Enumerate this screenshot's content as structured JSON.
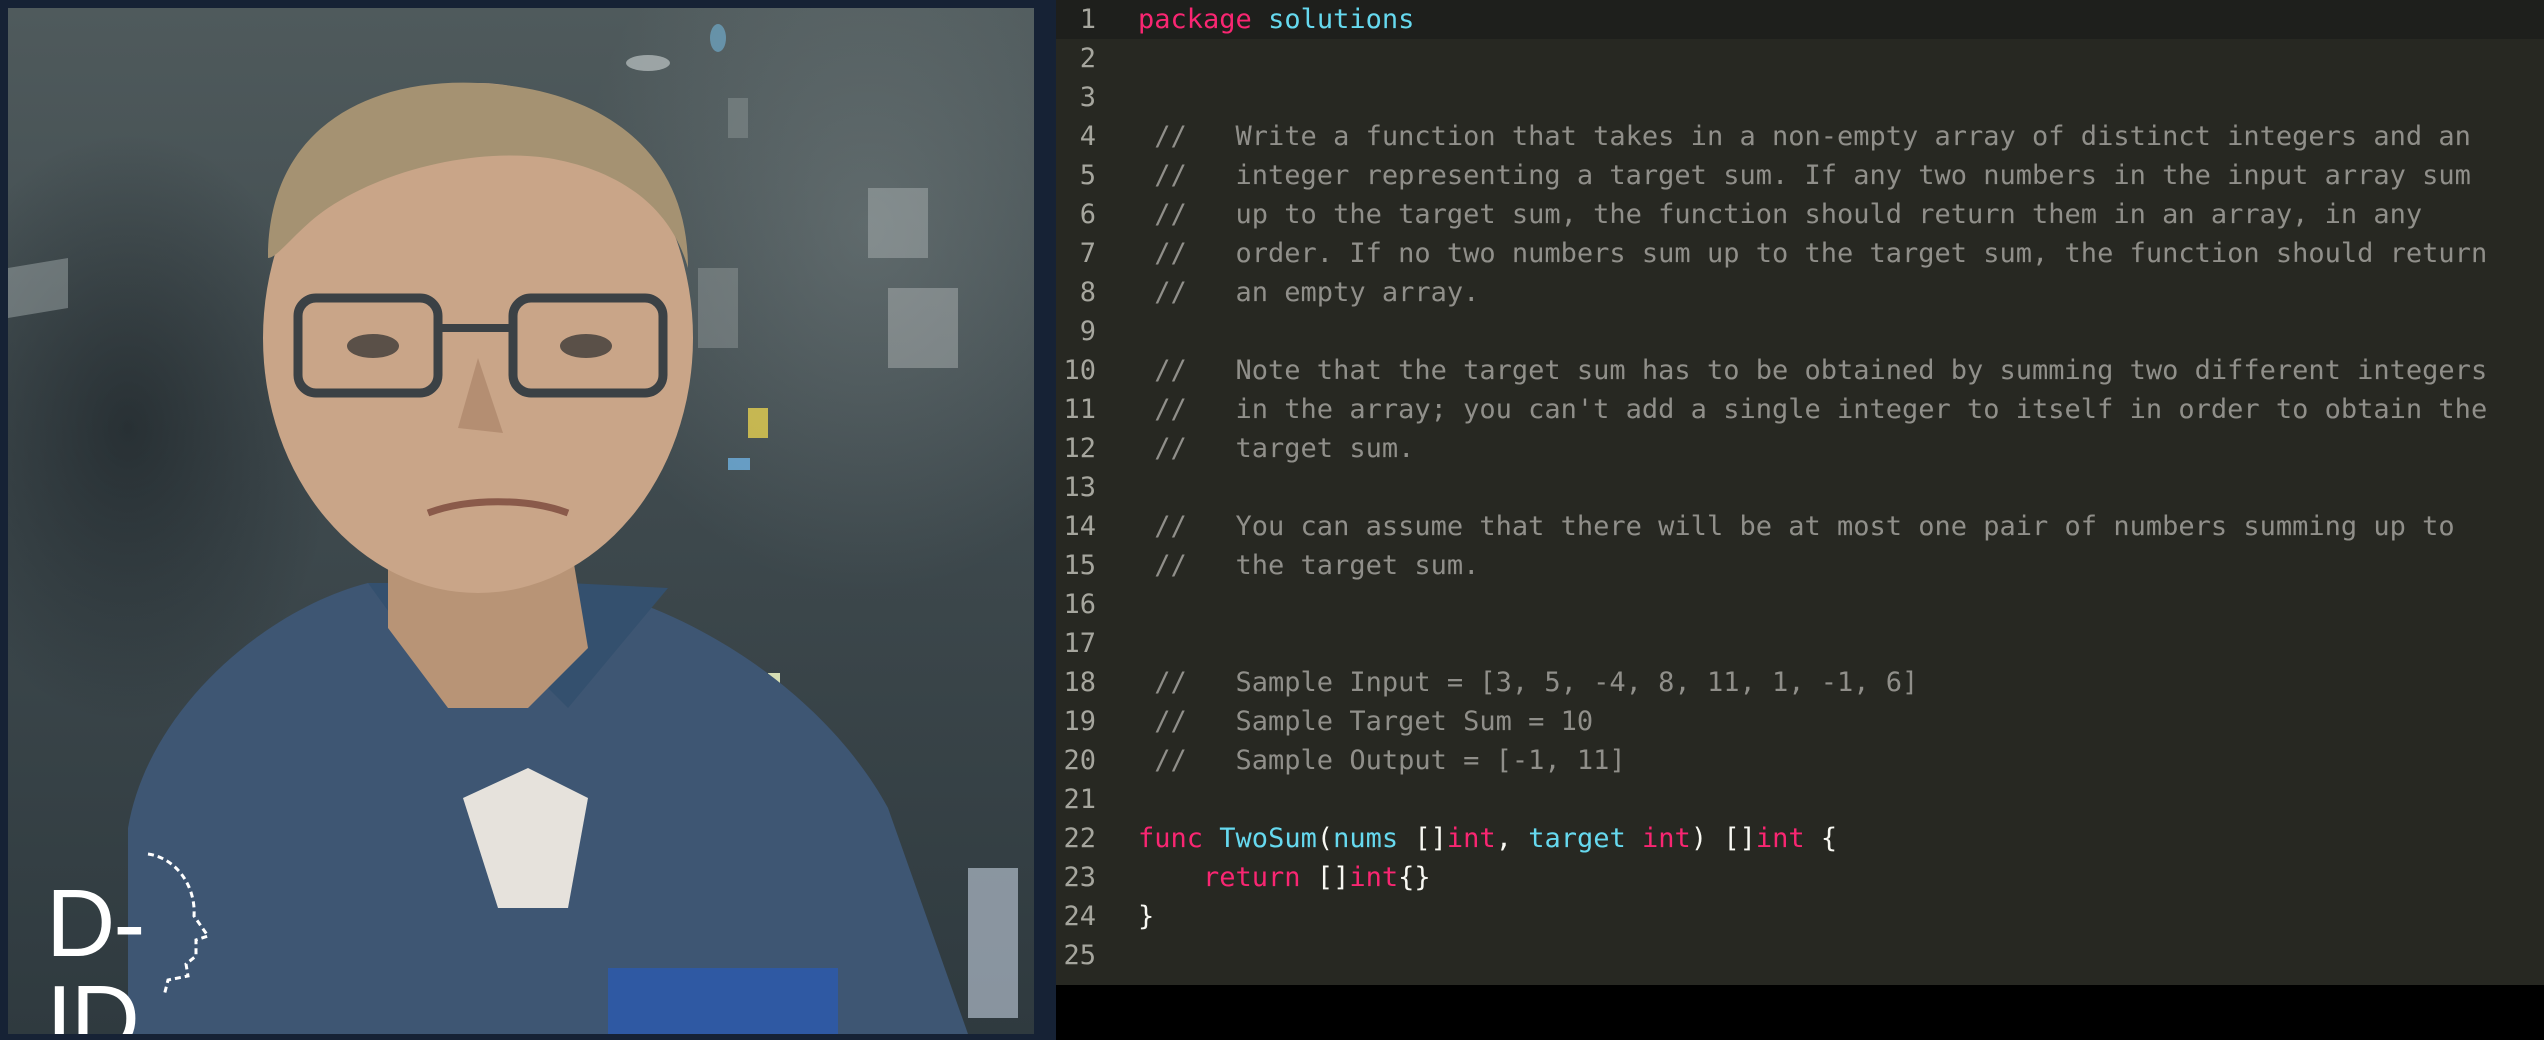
{
  "video": {
    "logo_text": "D-ID"
  },
  "editor": {
    "lines": [
      {
        "n": "1",
        "tokens": [
          {
            "t": "package",
            "c": "kw"
          },
          {
            "t": " "
          },
          {
            "t": "solutions",
            "c": "id2"
          }
        ]
      },
      {
        "n": "2",
        "tokens": []
      },
      {
        "n": "3",
        "tokens": []
      },
      {
        "n": "4",
        "tokens": [
          {
            "t": " //   Write a function that takes in a non-empty array of distinct integers and an",
            "c": "cm"
          }
        ]
      },
      {
        "n": "5",
        "tokens": [
          {
            "t": " //   integer representing a target sum. If any two numbers in the input array sum",
            "c": "cm"
          }
        ]
      },
      {
        "n": "6",
        "tokens": [
          {
            "t": " //   up to the target sum, the function should return them in an array, in any",
            "c": "cm"
          }
        ]
      },
      {
        "n": "7",
        "tokens": [
          {
            "t": " //   order. If no two numbers sum up to the target sum, the function should return",
            "c": "cm"
          }
        ]
      },
      {
        "n": "8",
        "tokens": [
          {
            "t": " //   an empty array.",
            "c": "cm"
          }
        ]
      },
      {
        "n": "9",
        "tokens": []
      },
      {
        "n": "10",
        "tokens": [
          {
            "t": " //   Note that the target sum has to be obtained by summing two different integers",
            "c": "cm"
          }
        ]
      },
      {
        "n": "11",
        "tokens": [
          {
            "t": " //   in the array; you can't add a single integer to itself in order to obtain the",
            "c": "cm"
          }
        ]
      },
      {
        "n": "12",
        "tokens": [
          {
            "t": " //   target sum.",
            "c": "cm"
          }
        ]
      },
      {
        "n": "13",
        "tokens": []
      },
      {
        "n": "14",
        "tokens": [
          {
            "t": " //   You can assume that there will be at most one pair of numbers summing up to",
            "c": "cm"
          }
        ]
      },
      {
        "n": "15",
        "tokens": [
          {
            "t": " //   the target sum.",
            "c": "cm"
          }
        ]
      },
      {
        "n": "16",
        "tokens": []
      },
      {
        "n": "17",
        "tokens": []
      },
      {
        "n": "18",
        "tokens": [
          {
            "t": " //   Sample Input = [3, 5, -4, 8, 11, 1, -1, 6]",
            "c": "cm"
          }
        ]
      },
      {
        "n": "19",
        "tokens": [
          {
            "t": " //   Sample Target Sum = 10",
            "c": "cm"
          }
        ]
      },
      {
        "n": "20",
        "tokens": [
          {
            "t": " //   Sample Output = [-1, 11]",
            "c": "cm"
          }
        ]
      },
      {
        "n": "21",
        "tokens": []
      },
      {
        "n": "22",
        "tokens": [
          {
            "t": "func",
            "c": "kw"
          },
          {
            "t": " "
          },
          {
            "t": "TwoSum",
            "c": "id2"
          },
          {
            "t": "("
          },
          {
            "t": "nums",
            "c": "id2"
          },
          {
            "t": " []"
          },
          {
            "t": "int",
            "c": "ty"
          },
          {
            "t": ", "
          },
          {
            "t": "target",
            "c": "id2"
          },
          {
            "t": " "
          },
          {
            "t": "int",
            "c": "ty"
          },
          {
            "t": ") []"
          },
          {
            "t": "int",
            "c": "ty"
          },
          {
            "t": " {"
          }
        ]
      },
      {
        "n": "23",
        "tokens": [
          {
            "t": "    "
          },
          {
            "t": "return",
            "c": "kw"
          },
          {
            "t": " []"
          },
          {
            "t": "int",
            "c": "ty"
          },
          {
            "t": "{}"
          }
        ]
      },
      {
        "n": "24",
        "tokens": [
          {
            "t": "}"
          }
        ]
      },
      {
        "n": "25",
        "tokens": []
      }
    ]
  }
}
